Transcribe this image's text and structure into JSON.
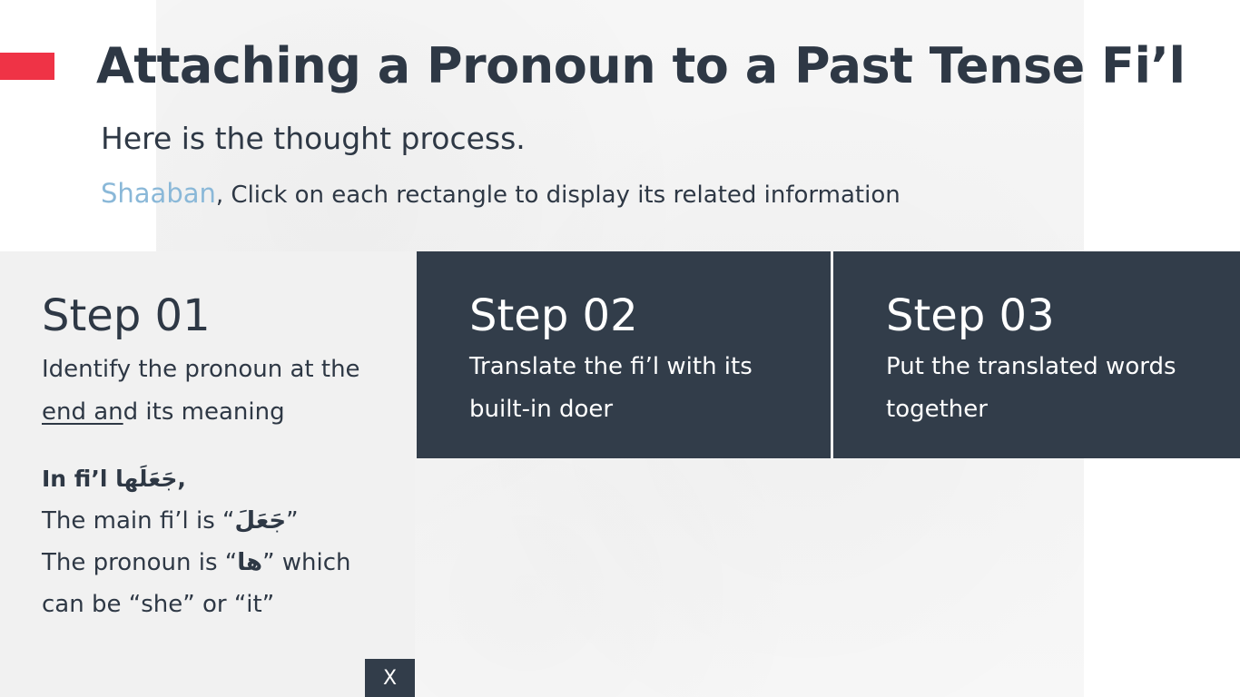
{
  "header": {
    "title": "Attaching a Pronoun to a Past Tense Fi’l",
    "subtitle": "Here is the thought process.",
    "user_name": "Shaaban",
    "instruction": ", Click on each rectangle to display its related information"
  },
  "steps": [
    {
      "title": "Step 01",
      "desc_line1": "Identify the pronoun at the",
      "desc_line2_underlined": "end an",
      "desc_line2_rest": "d its meaning"
    },
    {
      "title": "Step 02",
      "desc_line1": "Translate the fi’l with its",
      "desc_line2": "built-in doer"
    },
    {
      "title": "Step 03",
      "desc_line1": "Put the translated words",
      "desc_line2": "together"
    }
  ],
  "example": {
    "lead_text": "In fi’l ",
    "lead_arabic": "جَعَلَها",
    "lead_end": ",",
    "main_prefix": "The main fi’l is “",
    "main_arabic": "جَعَلَ",
    "main_suffix": "”",
    "pronoun_prefix": "The pronoun is “",
    "pronoun_arabic": "ها",
    "pronoun_suffix": "” which",
    "meaning": "can be “she” or “it”"
  },
  "close_button": {
    "label": "X"
  },
  "colors": {
    "accent": "#ef3346",
    "dark_panel": "#323d4a",
    "light_panel": "#f1f1f1",
    "text": "#2e3845",
    "name_highlight": "#8ab8d8"
  }
}
